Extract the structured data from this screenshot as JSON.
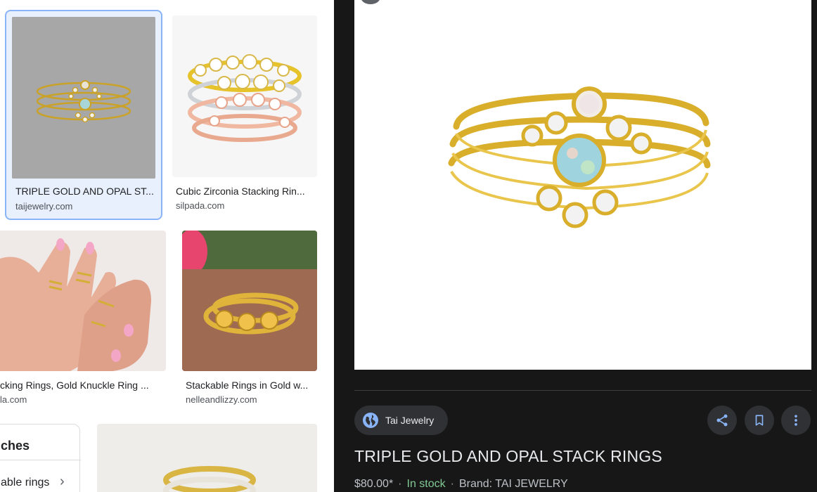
{
  "results": [
    {
      "caption": "TRIPLE GOLD AND OPAL ST...",
      "domain": "taijewelry.com"
    },
    {
      "caption": "Cubic Zirconia Stacking Rin...",
      "domain": "silpada.com"
    },
    {
      "caption": "cking Rings, Gold Knuckle Ring ...",
      "domain": "la.com"
    },
    {
      "caption": "Stackable Rings in Gold w...",
      "domain": "nelleandlizzy.com"
    }
  ],
  "related": {
    "title": "ches",
    "item": "able rings"
  },
  "detail": {
    "source_name": "Tai Jewelry",
    "title": "TRIPLE GOLD AND OPAL STACK RINGS",
    "price": "$80.00*",
    "stock": "In stock",
    "brand": "Brand: TAI JEWELRY"
  },
  "icons": {
    "source": "globe-icon",
    "share": "share-icon",
    "save": "bookmark-icon",
    "more": "more-vert-icon"
  },
  "colors": {
    "panel_bg": "#171717",
    "selected_border": "#8ab4f8",
    "in_stock": "#81c995"
  }
}
